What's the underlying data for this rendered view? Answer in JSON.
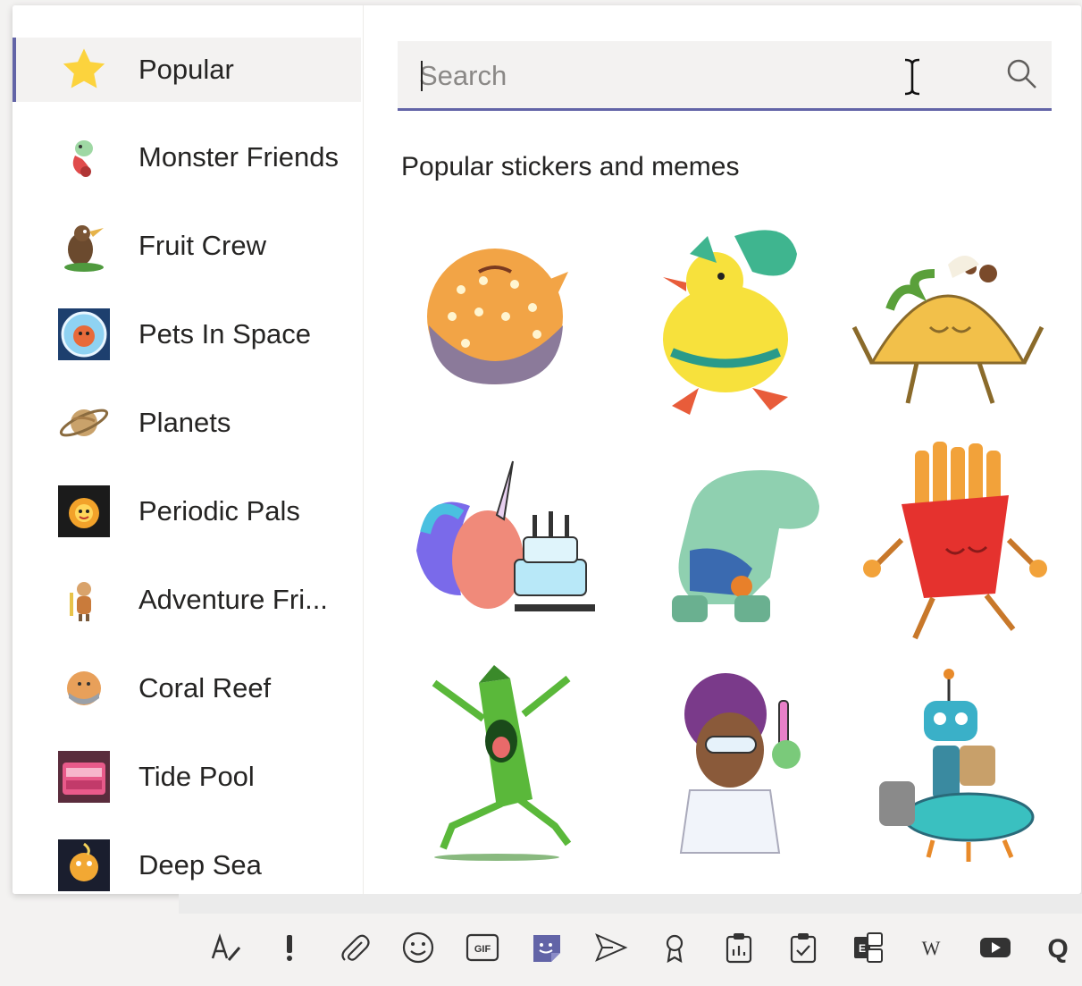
{
  "sidebar": {
    "items": [
      {
        "label": "Popular",
        "icon": "star-icon",
        "active": true
      },
      {
        "label": "Monster Friends",
        "icon": "monster-icon"
      },
      {
        "label": "Fruit Crew",
        "icon": "fruit-crew-icon"
      },
      {
        "label": "Pets In Space",
        "icon": "pets-in-space-icon"
      },
      {
        "label": "Planets",
        "icon": "planet-icon"
      },
      {
        "label": "Periodic Pals",
        "icon": "periodic-pals-icon"
      },
      {
        "label": "Adventure Fri...",
        "icon": "adventure-friends-icon"
      },
      {
        "label": "Coral Reef",
        "icon": "coral-reef-icon"
      },
      {
        "label": "Tide Pool",
        "icon": "tide-pool-icon"
      },
      {
        "label": "Deep Sea",
        "icon": "deep-sea-icon"
      }
    ]
  },
  "search": {
    "placeholder": "Search"
  },
  "main": {
    "section_title": "Popular stickers and memes",
    "stickers": [
      {
        "name": "pufferfish-sticker"
      },
      {
        "name": "party-duck-sticker"
      },
      {
        "name": "taco-sticker"
      },
      {
        "name": "unicorn-birthday-sticker"
      },
      {
        "name": "dinosaur-sticker"
      },
      {
        "name": "fries-sticker"
      },
      {
        "name": "crayon-sticker"
      },
      {
        "name": "scientist-sticker"
      },
      {
        "name": "robot-sticker"
      }
    ]
  },
  "toolbar": {
    "icons": [
      "format-icon",
      "important-icon",
      "attach-icon",
      "emoji-icon",
      "gif-icon",
      "sticker-icon",
      "schedule-send-icon",
      "praise-icon",
      "forms-icon",
      "approvals-icon",
      "updates-icon",
      "wikipedia-icon",
      "youtube-icon",
      "quizlet-icon"
    ],
    "gif_label": "GIF",
    "wiki_label": "W",
    "quizlet_label": "Q"
  },
  "colors": {
    "accent": "#6264a7",
    "panel_bg": "#ffffff",
    "hover_bg": "#f3f2f1"
  }
}
